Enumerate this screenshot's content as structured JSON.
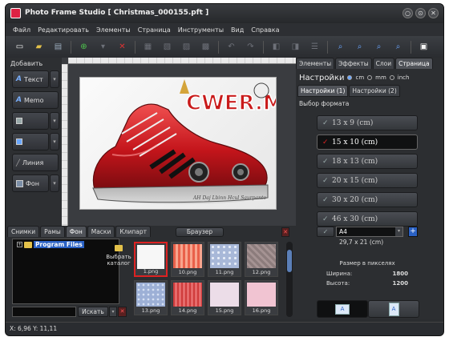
{
  "window": {
    "title": "Photo Frame Studio [ Christmas_000155.pft ]",
    "controls": [
      "○",
      "⊙",
      "✕"
    ]
  },
  "menu": [
    "Файл",
    "Редактировать",
    "Элементы",
    "Страница",
    "Инструменты",
    "Вид",
    "Справка"
  ],
  "left_panel": {
    "label": "Добавить",
    "buttons": [
      {
        "label": "Текст",
        "icon": "text-icon"
      },
      {
        "label": "Memo",
        "icon": "memo-icon"
      },
      {
        "label": "",
        "icon": "image-icon"
      },
      {
        "label": "",
        "icon": "shape-icon"
      },
      {
        "label": "Линия",
        "icon": "line-icon"
      },
      {
        "label": "Фон",
        "icon": "background-icon"
      }
    ]
  },
  "canvas": {
    "logo_text": "CWER.ML",
    "signature": "AH Daj Lbinn Hcul Saurpanto"
  },
  "bottom_panel": {
    "tabs": [
      "Снимки",
      "Рамы",
      "Фон",
      "Маски",
      "Клипарт"
    ],
    "active_tab": "Фон",
    "browser_button": "Браузер",
    "tree_root": "Program Files",
    "pick_catalog": "Выбрать каталог",
    "search_button": "Искать",
    "search_value": "",
    "thumbnails": [
      {
        "name": "1.png",
        "color": "#f7f7f7"
      },
      {
        "name": "10.png",
        "color": "#e9604a"
      },
      {
        "name": "11.png",
        "color": "#a8b8d8"
      },
      {
        "name": "12.png",
        "color": "#8c7c7c"
      },
      {
        "name": "13.png",
        "color": "#9db0d6"
      },
      {
        "name": "14.png",
        "color": "#cf3b3b"
      },
      {
        "name": "15.png",
        "color": "#ecdde8"
      },
      {
        "name": "16.png",
        "color": "#f1c4d2"
      }
    ]
  },
  "right_panel": {
    "tabs": [
      "Элементы",
      "Эффекты",
      "Слои",
      "Страница"
    ],
    "settings_title": "Настройки",
    "units": [
      "cm",
      "mm",
      "inch"
    ],
    "subtabs": [
      "Настройки (1)",
      "Настройки (2)"
    ],
    "format_label": "Выбор формата",
    "formats": [
      "13 x 9 (cm)",
      "15 x 10 (cm)",
      "18 x 13 (cm)",
      "20 x 15 (cm)",
      "30 x 20 (cm)",
      "46 x 30 (cm)"
    ],
    "selected_format": "15 x 10 (cm)",
    "paper": "A4",
    "paper_size": "29,7 x 21 (cm)",
    "pixel_title": "Размер в пикселях",
    "width_label": "Ширина:",
    "width_value": "1800",
    "height_label": "Высота:",
    "height_value": "1200",
    "orientation_icon": "A"
  },
  "status": {
    "coords": "X: 6,96 Y: 11,11"
  },
  "accent_colors": {
    "selection": "#d22222",
    "highlight": "#2a61c4"
  }
}
